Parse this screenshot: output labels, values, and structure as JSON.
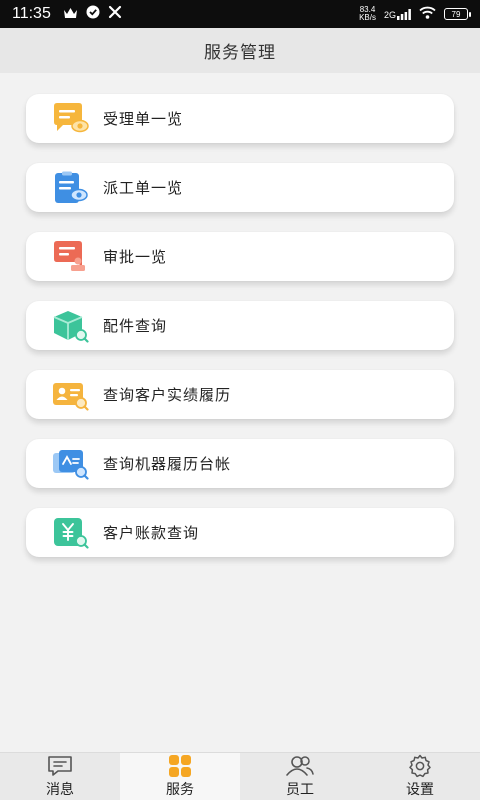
{
  "status_bar": {
    "time": "11:35",
    "net_speed_value": "83.4",
    "net_speed_unit": "KB/s",
    "signal_label": "2G",
    "battery": "79"
  },
  "header": {
    "title": "服务管理"
  },
  "menu": {
    "items": [
      {
        "label": "受理单一览",
        "icon": "accept-list-icon",
        "color": "#f4b13a"
      },
      {
        "label": "派工单一览",
        "icon": "dispatch-list-icon",
        "color": "#3f8fe3"
      },
      {
        "label": "审批一览",
        "icon": "approval-list-icon",
        "color": "#ec6a55"
      },
      {
        "label": "配件查询",
        "icon": "parts-search-icon",
        "color": "#3cc49a"
      },
      {
        "label": "查询客户实绩履历",
        "icon": "customer-history-icon",
        "color": "#f5b43e"
      },
      {
        "label": "查询机器履历台帐",
        "icon": "machine-ledger-icon",
        "color": "#3f8fe3"
      },
      {
        "label": "客户账款查询",
        "icon": "customer-account-icon",
        "color": "#3cc49a"
      }
    ]
  },
  "tabbar": {
    "tabs": [
      {
        "label": "消息",
        "icon": "message-icon"
      },
      {
        "label": "服务",
        "icon": "service-icon",
        "active": true
      },
      {
        "label": "员工",
        "icon": "staff-icon"
      },
      {
        "label": "设置",
        "icon": "settings-icon"
      }
    ],
    "accent": "#f5a623"
  }
}
